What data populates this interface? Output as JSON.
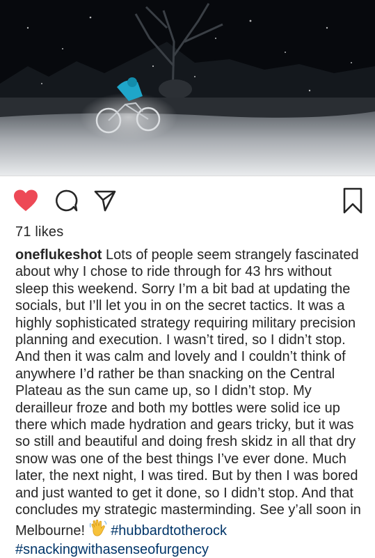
{
  "post": {
    "image_alt": "Cyclist riding a bike with glowing wheels through snow at night",
    "likes_text": "71 likes",
    "username": "oneflukeshot",
    "caption_main": " Lots of people seem strangely fascinated about why I chose to ride through for 43 hrs without sleep this weekend. Sorry I’m a bit bad at updating the socials, but I’ll let you in on the secret tactics. It was a highly sophisticated strategy requiring military precision planning and execution. I wasn’t tired, so I didn’t stop. And then it was calm and lovely and I couldn’t think of anywhere I’d rather be than snacking on the Central Plateau as the sun came up, so I didn’t stop. My derailleur froze and both my bottles were solid ice up there which made hydration and gears tricky, but it was so still and beautiful and doing fresh skidz in all that dry snow was one of the best things I’ve ever done. Much later, the next night, I was tired. But by then I was bored and just wanted to get it done, so I didn’t stop. And that concludes my strategic masterminding. See y’all soon in Melbourne! ",
    "emoji": "waving-hand",
    "hashtags": [
      "#hubbardtotherock",
      "#snackingwithasenseofurgency"
    ]
  },
  "actions": {
    "like": "heart-icon",
    "comment": "comment-icon",
    "share": "share-icon",
    "save": "bookmark-icon"
  },
  "colors": {
    "like_active": "#ed4956",
    "hashtag": "#003569",
    "text": "#262626"
  }
}
